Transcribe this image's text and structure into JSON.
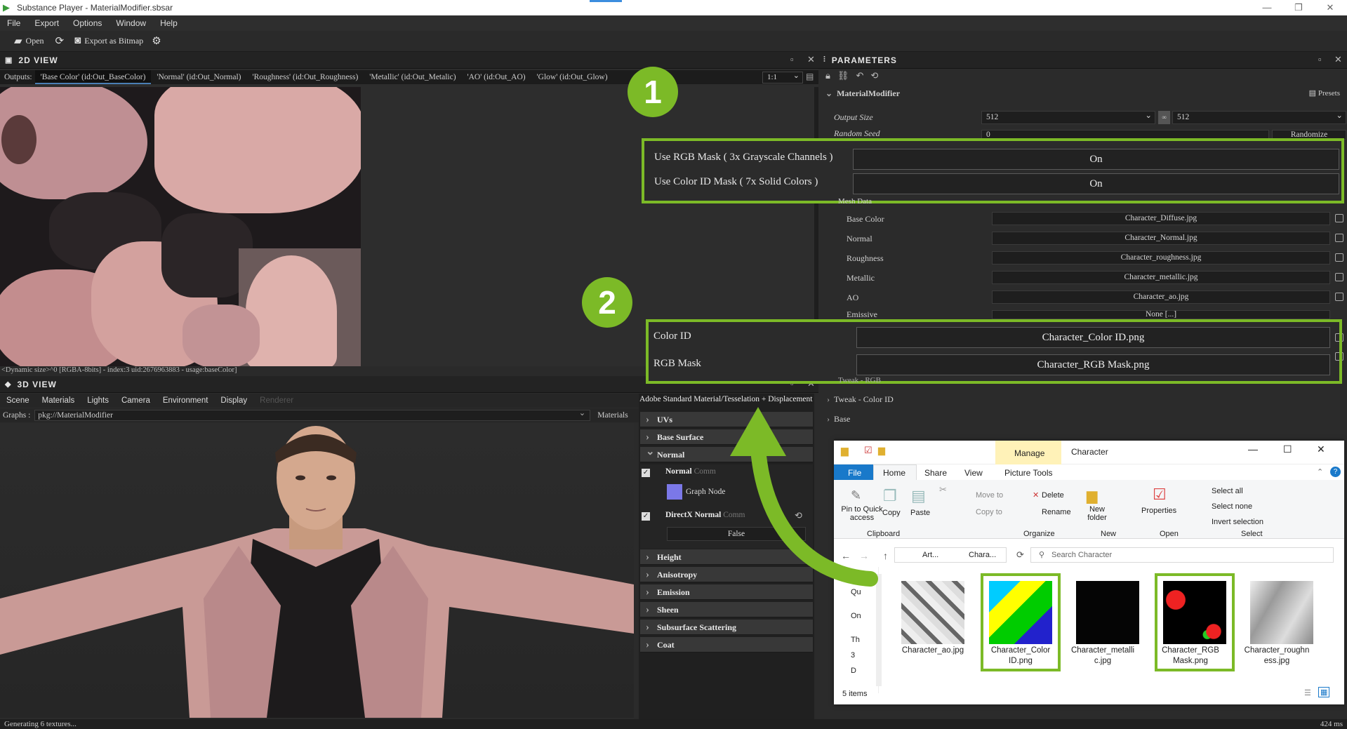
{
  "window": {
    "title": "Substance Player - MaterialModifier.sbsar"
  },
  "menu": [
    "File",
    "Export",
    "Options",
    "Window",
    "Help"
  ],
  "toolbar": {
    "open": "Open",
    "export_bitmap": "Export as Bitmap"
  },
  "view2d": {
    "title": "2D VIEW",
    "outputs_label": "Outputs:",
    "tabs": [
      "'Base Color' (id:Out_BaseColor)",
      "'Normal' (id:Out_Normal)",
      "'Roughness' (id:Out_Roughness)",
      "'Metallic' (id:Out_Metalic)",
      "'AO' (id:Out_AO)",
      "'Glow' (id:Out_Glow)"
    ],
    "zoom": "1:1",
    "info": "<Dynamic size>^0 [RGBA-8bits] - index:3 uid:2676963883 - usage:baseColor]"
  },
  "view3d": {
    "title": "3D VIEW",
    "tabs": [
      "Scene",
      "Materials",
      "Lights",
      "Camera",
      "Environment",
      "Display",
      "Renderer"
    ],
    "graphs_label": "Graphs :",
    "graphs_value": "pkg://MaterialModifier",
    "materials_label": "Materials"
  },
  "material_panel": {
    "title": "Adobe Standard Material/Tesselation + Displacement",
    "sections_top": [
      "UVs",
      "Base Surface",
      "Normal"
    ],
    "normal_label": "Normal",
    "normal_suffix": "Comm",
    "graph_node": "Graph Node",
    "directx_label": "DirectX Normal",
    "directx_suffix": "Comm",
    "directx_value": "False",
    "sections_bottom": [
      "Height",
      "Anisotropy",
      "Emission",
      "Sheen",
      "Subsurface Scattering",
      "Coat"
    ]
  },
  "parameters": {
    "title": "PARAMETERS",
    "graph": "MaterialModifier",
    "presets": "Presets",
    "output_size_label": "Output Size",
    "output_size_a": "512",
    "output_size_b": "512",
    "random_seed_label": "Random Seed",
    "random_seed_value": "0",
    "randomize": "Randomize",
    "rgb_mask_label": "Use RGB Mask ( 3x Grayscale Channels )",
    "rgb_mask_value": "On",
    "color_id_mask_label": "Use Color ID Mask ( 7x Solid Colors )",
    "color_id_mask_value": "On",
    "mesh_data_label": "Mesh Data",
    "inputs": [
      {
        "label": "Base Color",
        "value": "Character_Diffuse.jpg"
      },
      {
        "label": "Normal",
        "value": "Character_Normal.jpg"
      },
      {
        "label": "Roughness",
        "value": "Character_roughness.jpg"
      },
      {
        "label": "Metallic",
        "value": "Character_metallic.jpg"
      },
      {
        "label": "AO",
        "value": "Character_ao.jpg"
      },
      {
        "label": "Emissive",
        "value": "None [...]"
      }
    ],
    "color_id_label": "Color ID",
    "color_id_value": "Character_Color ID.png",
    "rgb_label": "RGB Mask",
    "rgb_value": "Character_RGB Mask.png",
    "tweak_rgb": "Tweak - RGB",
    "tweak_color_id": "Tweak - Color ID",
    "base": "Base"
  },
  "callouts": {
    "one": "1",
    "two": "2"
  },
  "explorer": {
    "manage": "Manage",
    "folder": "Character",
    "tabs": [
      "File",
      "Home",
      "Share",
      "View",
      "Picture Tools"
    ],
    "ribbon": {
      "pin": "Pin to Quick access",
      "copy": "Copy",
      "paste": "Paste",
      "clipboard": "Clipboard",
      "move_to": "Move to",
      "delete": "Delete",
      "copy_to": "Copy to",
      "rename": "Rename",
      "organize": "Organize",
      "new_folder": "New folder",
      "new": "New",
      "properties": "Properties",
      "open": "Open",
      "select_all": "Select all",
      "select_none": "Select none",
      "invert_selection": "Invert selection",
      "select": "Select"
    },
    "path_a": "Art...",
    "path_b": "Chara...",
    "search_placeholder": "Search Character",
    "nav_items": [
      "Qu",
      "On",
      "Th",
      "3",
      "D"
    ],
    "files": [
      "Character_ao.jpg",
      "Character_Color ID.png",
      "Character_metallic.jpg",
      "Character_RGB Mask.png",
      "Character_roughness.jpg"
    ],
    "item_count": "5 items"
  },
  "status": {
    "left": "Generating 6 textures...",
    "right": "424 ms"
  },
  "colors": {
    "accent_green": "#7cba27",
    "bg": "#2b2b2b"
  }
}
